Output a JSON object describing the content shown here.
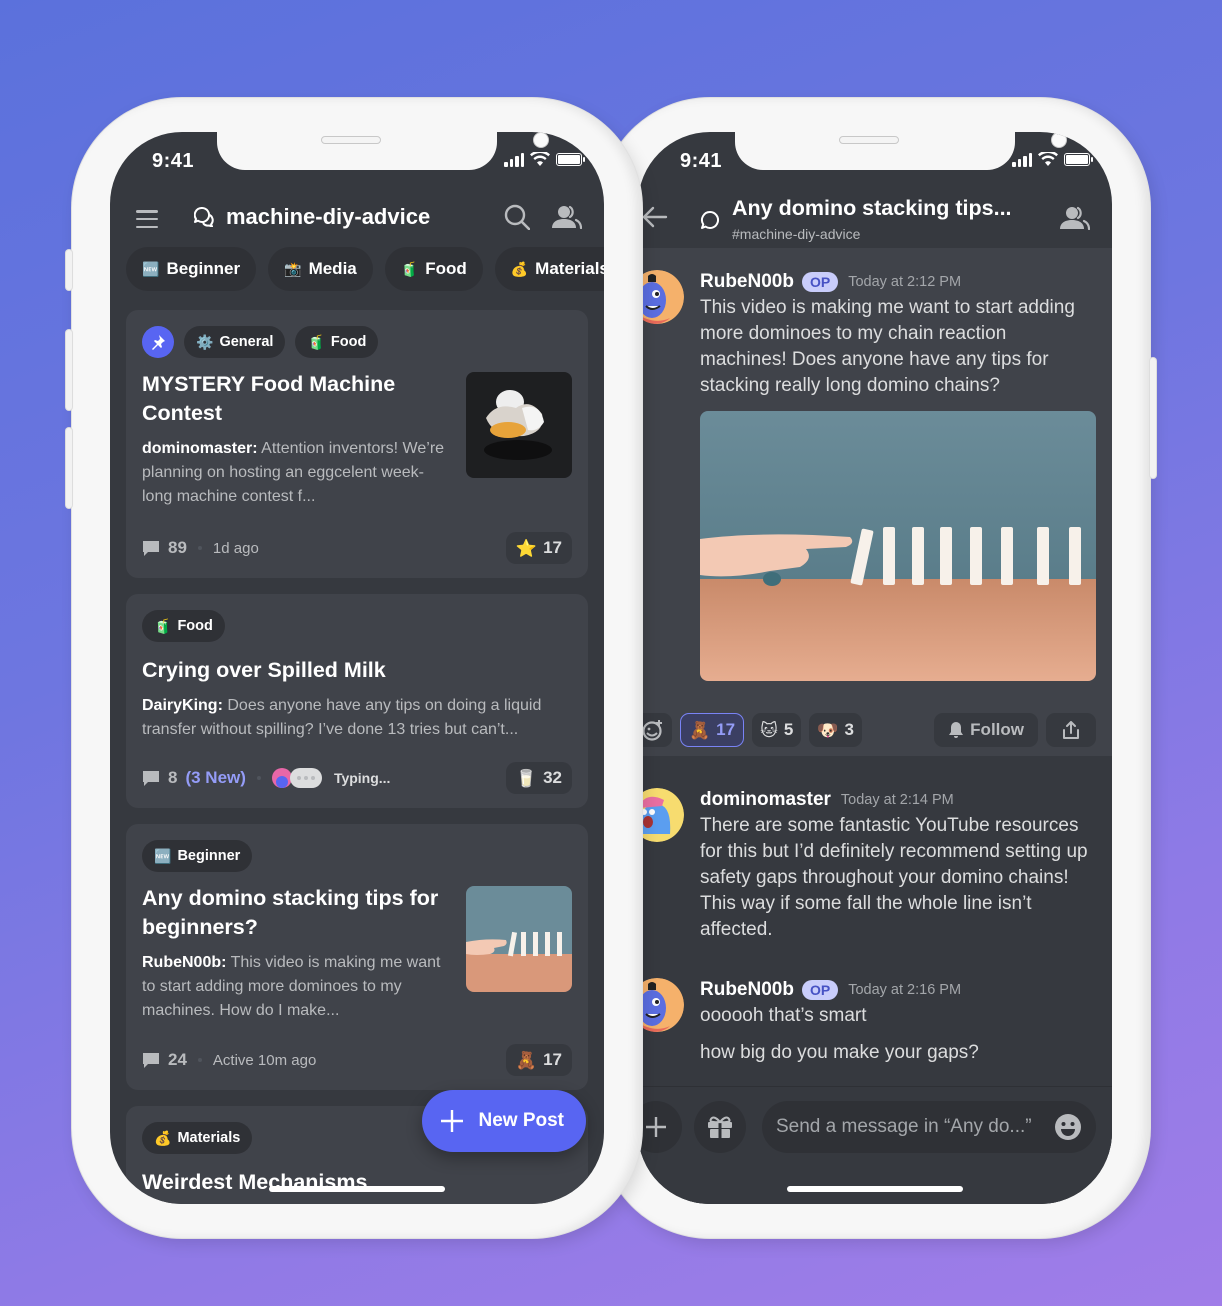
{
  "colors": {
    "accent": "#5865f2",
    "background_top": "#5b71dc",
    "background_bottom": "#a07de8",
    "screen_bg": "#36393f",
    "card_bg": "#40434a"
  },
  "left_phone": {
    "status": {
      "time": "9:41"
    },
    "header": {
      "channel_icon": "threads-icon",
      "channel_name": "machine-diy-advice"
    },
    "filter_tags": [
      {
        "emoji": "🆕",
        "label": "Beginner"
      },
      {
        "emoji": "📸",
        "label": "Media"
      },
      {
        "emoji": "🧃",
        "label": "Food"
      },
      {
        "emoji": "💰",
        "label": "Materials"
      }
    ],
    "posts": [
      {
        "pinned": true,
        "tags": [
          {
            "emoji": "⚙️",
            "label": "General"
          },
          {
            "emoji": "🧃",
            "label": "Food"
          }
        ],
        "title": "MYSTERY Food Machine Contest",
        "author": "dominomaster:",
        "excerpt": "Attention inventors! We’re planning on hosting an eggcelent week-long machine contest f...",
        "thumbnail": "cracked-egg-image",
        "message_count": "89",
        "time": "1d ago",
        "reaction_emoji": "⭐",
        "reaction_count": "17"
      },
      {
        "tags": [
          {
            "emoji": "🧃",
            "label": "Food"
          }
        ],
        "title": "Crying over Spilled Milk",
        "author": "DairyKing:",
        "excerpt": "Does anyone have any tips on doing a liquid transfer without spilling? I’ve done 13 tries but can’t...",
        "message_count": "8",
        "new_count": "(3 New)",
        "typing_text": "Typing...",
        "reaction_emoji": "🥛",
        "reaction_count": "32"
      },
      {
        "tags": [
          {
            "emoji": "🆕",
            "label": "Beginner"
          }
        ],
        "title": "Any domino stacking tips for beginners?",
        "author": "RubeN00b:",
        "excerpt": "This video is making me want to start adding more dominoes to my machines. How do I make...",
        "thumbnail": "domino-image",
        "message_count": "24",
        "time": "Active 10m ago",
        "reaction_emoji": "🧸",
        "reaction_count": "17"
      },
      {
        "tags": [
          {
            "emoji": "💰",
            "label": "Materials"
          }
        ],
        "title": "Weirdest Mechanisms"
      }
    ],
    "fab_label": "New Post"
  },
  "right_phone": {
    "status": {
      "time": "9:41"
    },
    "header": {
      "title": "Any domino stacking tips...",
      "subtitle": "#machine-diy-advice"
    },
    "messages": [
      {
        "username": "RubeN00b",
        "badge": "OP",
        "timestamp": "Today at 2:12 PM",
        "lines": [
          "This video is making me want to start adding more dominoes to my chain reaction machines! Does anyone have any tips for stacking really long domino chains?"
        ],
        "attachment": "domino-video"
      },
      {
        "username": "dominomaster",
        "timestamp": "Today at 2:14 PM",
        "lines": [
          "There are some fantastic YouTube resources for this but I’d definitely recommend setting up safety gaps throughout your domino chains! This way if some fall the whole line isn’t affected."
        ]
      },
      {
        "username": "RubeN00b",
        "badge": "OP",
        "timestamp": "Today at 2:16 PM",
        "lines": [
          "oooooh that’s smart",
          "how big do you make your gaps?"
        ]
      }
    ],
    "reactions": [
      {
        "emoji": "🧸",
        "count": "17",
        "active": true
      },
      {
        "emoji": "🐱",
        "count": "5"
      },
      {
        "emoji": "🐶",
        "count": "3"
      }
    ],
    "follow_label": "Follow",
    "composer_placeholder": "Send a message in “Any do...”"
  }
}
